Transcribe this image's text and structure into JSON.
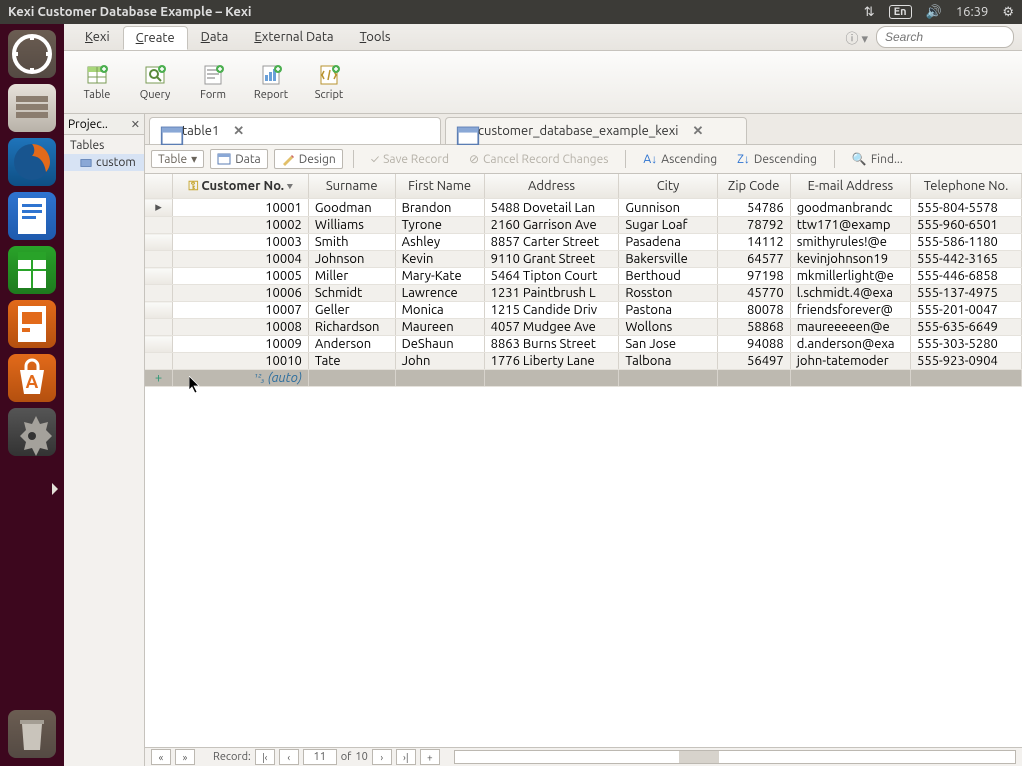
{
  "menubar": {
    "title": "Kexi Customer Database Example – Kexi",
    "language": "En",
    "time": "16:39"
  },
  "launcher": {
    "items": [
      {
        "name": "dash",
        "glyph": "◌"
      },
      {
        "name": "files",
        "glyph": "🗂"
      },
      {
        "name": "firefox",
        "glyph": ""
      },
      {
        "name": "writer",
        "glyph": ""
      },
      {
        "name": "calc",
        "glyph": ""
      },
      {
        "name": "impress",
        "glyph": ""
      },
      {
        "name": "software",
        "glyph": "A"
      },
      {
        "name": "settings",
        "glyph": ""
      },
      {
        "name": "kexi",
        "glyph": ""
      }
    ],
    "trash": {
      "glyph": "🗑"
    }
  },
  "ribbon": {
    "tabs": [
      "Kexi",
      "Create",
      "Data",
      "External Data",
      "Tools"
    ],
    "active": 1,
    "search_placeholder": "Search",
    "buttons": [
      {
        "id": "table",
        "label": "Table"
      },
      {
        "id": "query",
        "label": "Query"
      },
      {
        "id": "form",
        "label": "Form"
      },
      {
        "id": "report",
        "label": "Report"
      },
      {
        "id": "script",
        "label": "Script"
      }
    ]
  },
  "project_nav": {
    "title": "Projec..",
    "group": "Tables",
    "items": [
      "custom"
    ]
  },
  "doc_tabs": [
    {
      "label": "table1",
      "active": true
    },
    {
      "label": "customer_database_example_kexi",
      "active": false
    }
  ],
  "toolbar": {
    "mode": "Table",
    "data": "Data",
    "design": "Design",
    "save": "Save Record",
    "cancel": "Cancel Record Changes",
    "asc": "Ascending",
    "desc": "Descending",
    "find": "Find..."
  },
  "table": {
    "columns": [
      "Customer No.",
      "Surname",
      "First Name",
      "Address",
      "City",
      "Zip Code",
      "E-mail Address",
      "Telephone No."
    ],
    "sort_column": 0,
    "rows": [
      {
        "no": 10001,
        "surname": "Goodman",
        "first": "Brandon",
        "addr": "5488 Dovetail Lan",
        "city": "Gunnison",
        "zip": 54786,
        "email": "goodmanbrandc",
        "tel": "555-804-5578"
      },
      {
        "no": 10002,
        "surname": "Williams",
        "first": "Tyrone",
        "addr": "2160 Garrison Ave",
        "city": "Sugar Loaf",
        "zip": 78792,
        "email": "ttw171@examp",
        "tel": "555-960-6501"
      },
      {
        "no": 10003,
        "surname": "Smith",
        "first": "Ashley",
        "addr": "8857 Carter Street",
        "city": "Pasadena",
        "zip": 14112,
        "email": "smithyrules!@e",
        "tel": "555-586-1180"
      },
      {
        "no": 10004,
        "surname": "Johnson",
        "first": "Kevin",
        "addr": "9110 Grant Street",
        "city": "Bakersville",
        "zip": 64577,
        "email": "kevinjohnson19",
        "tel": "555-442-3165"
      },
      {
        "no": 10005,
        "surname": "Miller",
        "first": "Mary-Kate",
        "addr": "5464 Tipton Court",
        "city": "Berthoud",
        "zip": 97198,
        "email": "mkmillerlight@e",
        "tel": "555-446-6858"
      },
      {
        "no": 10006,
        "surname": "Schmidt",
        "first": "Lawrence",
        "addr": "1231 Paintbrush L",
        "city": "Rosston",
        "zip": 45770,
        "email": "l.schmidt.4@exa",
        "tel": "555-137-4975"
      },
      {
        "no": 10007,
        "surname": "Geller",
        "first": "Monica",
        "addr": "1215 Candide Driv",
        "city": "Pastona",
        "zip": 80078,
        "email": "friendsforever@",
        "tel": "555-201-0047"
      },
      {
        "no": 10008,
        "surname": "Richardson",
        "first": "Maureen",
        "addr": "4057 Mudgee Ave",
        "city": "Wollons",
        "zip": 58868,
        "email": "maureeeeen@e",
        "tel": "555-635-6649"
      },
      {
        "no": 10009,
        "surname": "Anderson",
        "first": "DeShaun",
        "addr": "8863 Burns Street",
        "city": "San Jose",
        "zip": 94088,
        "email": "d.anderson@exa",
        "tel": "555-303-5280"
      },
      {
        "no": 10010,
        "surname": "Tate",
        "first": "John",
        "addr": "1776 Liberty Lane",
        "city": "Talbona",
        "zip": 56497,
        "email": "john-tatemoder",
        "tel": "555-923-0904"
      }
    ],
    "auto_label": "(auto)",
    "widths": [
      140,
      82,
      88,
      134,
      106,
      68,
      116,
      110
    ]
  },
  "record_bar": {
    "label": "Record:",
    "current": "11",
    "of": "of",
    "total": "10"
  }
}
